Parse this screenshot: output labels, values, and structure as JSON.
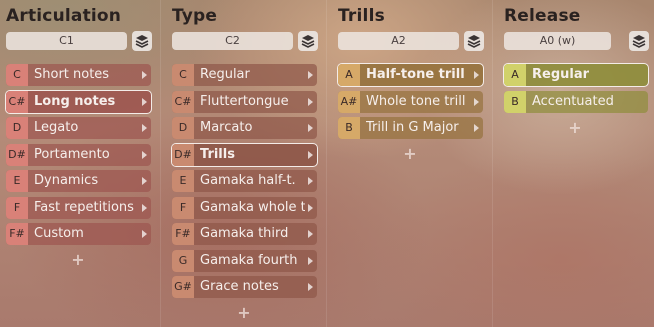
{
  "colors": {
    "articulation_key": "#d98178",
    "articulation_row": "#9d5550",
    "type_key": "#c98a70",
    "type_row": "#8e5748",
    "trills_key": "#d6a968",
    "trills_row": "#96723d",
    "release_key": "#d1d16a",
    "release_row": "#8e8d3a"
  },
  "columns": [
    {
      "title": "Articulation",
      "key": "C1",
      "layer_icon": "layers-icon",
      "items": [
        {
          "key": "C",
          "label": "Short notes",
          "arrow": true,
          "selected": false
        },
        {
          "key": "C#",
          "label": "Long notes",
          "arrow": true,
          "selected": true
        },
        {
          "key": "D",
          "label": "Legato",
          "arrow": true,
          "selected": false
        },
        {
          "key": "D#",
          "label": "Portamento",
          "arrow": true,
          "selected": false
        },
        {
          "key": "E",
          "label": "Dynamics",
          "arrow": true,
          "selected": false
        },
        {
          "key": "F",
          "label": "Fast repetitions",
          "arrow": true,
          "selected": false
        },
        {
          "key": "F#",
          "label": "Custom",
          "arrow": true,
          "selected": false
        }
      ],
      "add": "+"
    },
    {
      "title": "Type",
      "key": "C2",
      "layer_icon": "layers-icon",
      "items": [
        {
          "key": "C",
          "label": "Regular",
          "arrow": true,
          "selected": false
        },
        {
          "key": "C#",
          "label": "Fluttertongue",
          "arrow": true,
          "selected": false
        },
        {
          "key": "D",
          "label": "Marcato",
          "arrow": true,
          "selected": false
        },
        {
          "key": "D#",
          "label": "Trills",
          "arrow": true,
          "selected": true
        },
        {
          "key": "E",
          "label": "Gamaka half-t.",
          "arrow": true,
          "selected": false
        },
        {
          "key": "F",
          "label": "Gamaka whole t",
          "arrow": true,
          "selected": false
        },
        {
          "key": "F#",
          "label": "Gamaka third",
          "arrow": true,
          "selected": false
        },
        {
          "key": "G",
          "label": "Gamaka fourth",
          "arrow": true,
          "selected": false
        },
        {
          "key": "G#",
          "label": "Grace notes",
          "arrow": true,
          "selected": false
        }
      ],
      "add": "+"
    },
    {
      "title": "Trills",
      "key": "A2",
      "layer_icon": "layers-icon",
      "items": [
        {
          "key": "A",
          "label": "Half-tone trill",
          "arrow": true,
          "selected": true
        },
        {
          "key": "A#",
          "label": "Whole tone trill",
          "arrow": true,
          "selected": false
        },
        {
          "key": "B",
          "label": "Trill in G Major",
          "arrow": true,
          "selected": false
        }
      ],
      "add": "+"
    },
    {
      "title": "Release",
      "key": "A0 (w)",
      "layer_icon": "layers-icon",
      "items": [
        {
          "key": "A",
          "label": "Regular",
          "arrow": false,
          "selected": true
        },
        {
          "key": "B",
          "label": "Accentuated",
          "arrow": false,
          "selected": false
        }
      ],
      "add": "+"
    }
  ]
}
